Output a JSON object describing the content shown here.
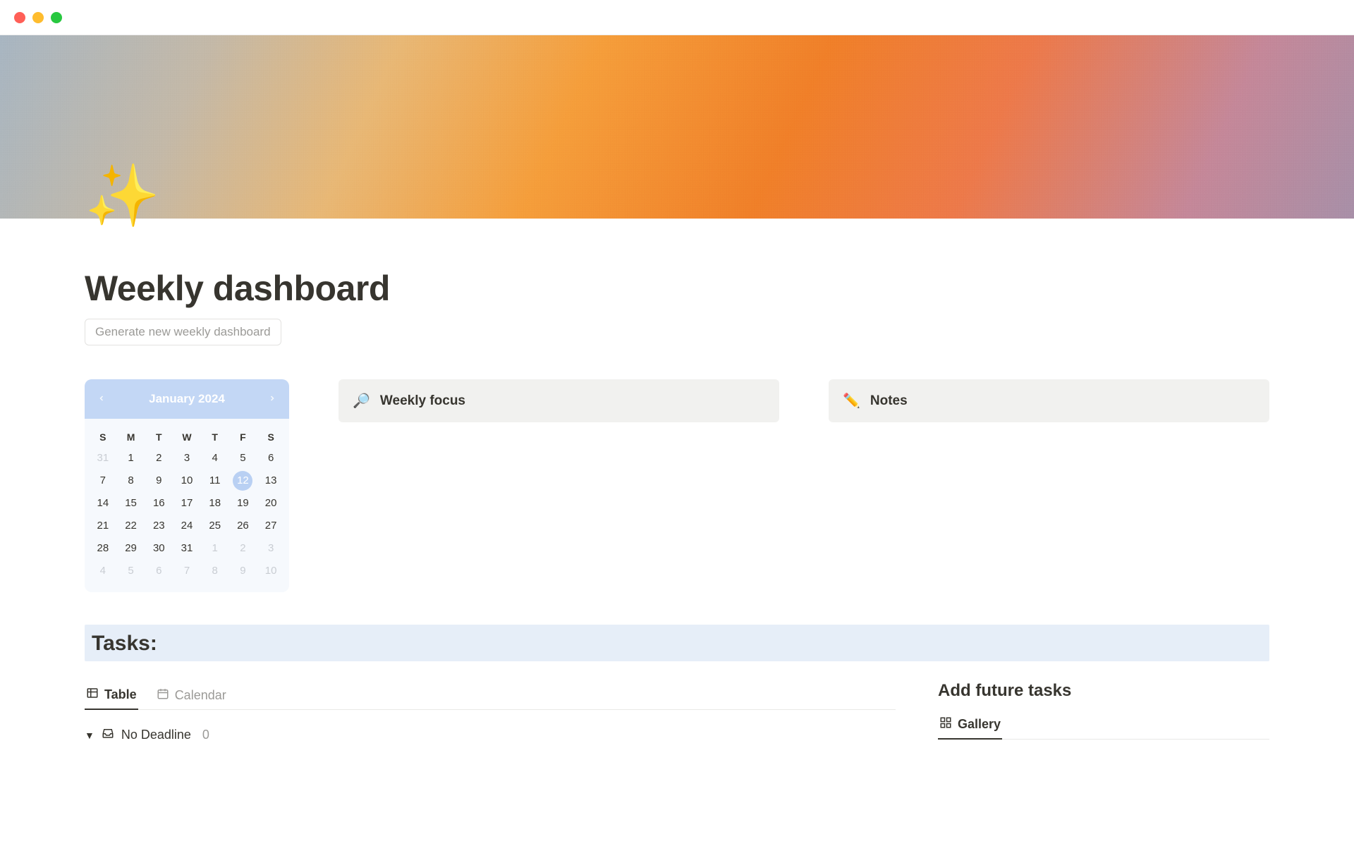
{
  "icons": {
    "sparkles": "✨"
  },
  "page": {
    "title": "Weekly dashboard",
    "generate_button": "Generate new weekly dashboard"
  },
  "calendar": {
    "month_label": "January 2024",
    "dow": [
      "S",
      "M",
      "T",
      "W",
      "T",
      "F",
      "S"
    ],
    "leading_muted": [
      31
    ],
    "days": [
      1,
      2,
      3,
      4,
      5,
      6,
      7,
      8,
      9,
      10,
      11,
      12,
      13,
      14,
      15,
      16,
      17,
      18,
      19,
      20,
      21,
      22,
      23,
      24,
      25,
      26,
      27,
      28,
      29,
      30,
      31
    ],
    "trailing_muted": [
      1,
      2,
      3,
      4,
      5,
      6,
      7,
      8,
      9,
      10
    ],
    "selected_day": 12
  },
  "callouts": {
    "focus": {
      "emoji": "🔎",
      "label": "Weekly focus"
    },
    "notes": {
      "emoji": "✏️",
      "label": "Notes"
    }
  },
  "tasks": {
    "heading": "Tasks:",
    "tabs": {
      "table": "Table",
      "calendar": "Calendar"
    },
    "group": {
      "name": "No Deadline",
      "count": "0"
    }
  },
  "future": {
    "heading": "Add future tasks",
    "tab": "Gallery"
  }
}
